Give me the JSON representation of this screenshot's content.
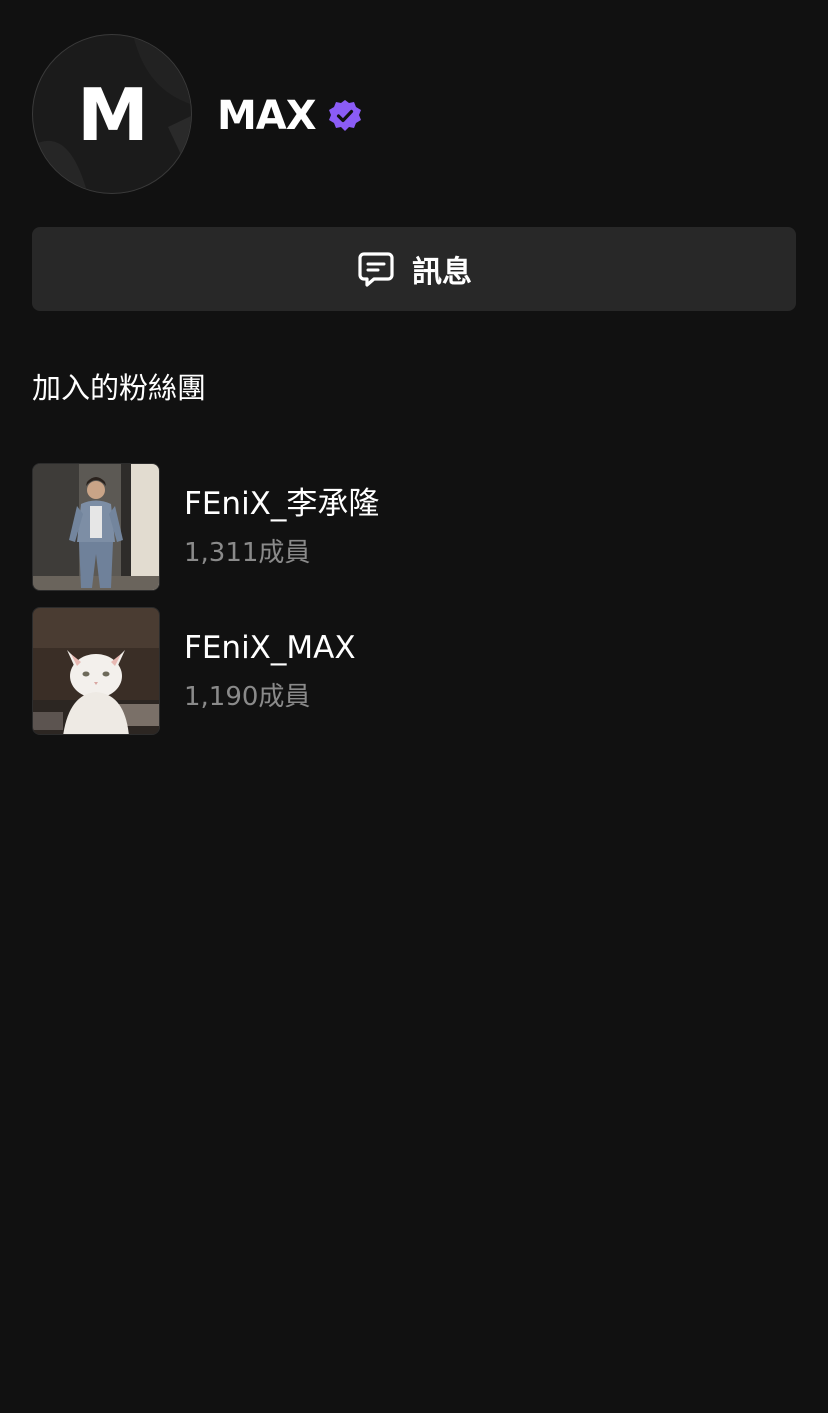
{
  "profile": {
    "avatar_letter": "M",
    "name": "MAX",
    "verified_icon": "verified-badge-icon",
    "verified_color": "#8b5cf6"
  },
  "message_button": {
    "icon": "chat-bubble-icon",
    "label": "訊息"
  },
  "fan_clubs": {
    "title": "加入的粉絲團",
    "items": [
      {
        "name": "FEniX_李承隆",
        "members": "1,311成員",
        "thumbnail": "person-photo"
      },
      {
        "name": "FEniX_MAX",
        "members": "1,190成員",
        "thumbnail": "white-kitten-photo"
      }
    ]
  },
  "colors": {
    "background": "#111111",
    "button_bg": "#282828",
    "muted_text": "#8a8a8a",
    "accent": "#8b5cf6"
  }
}
